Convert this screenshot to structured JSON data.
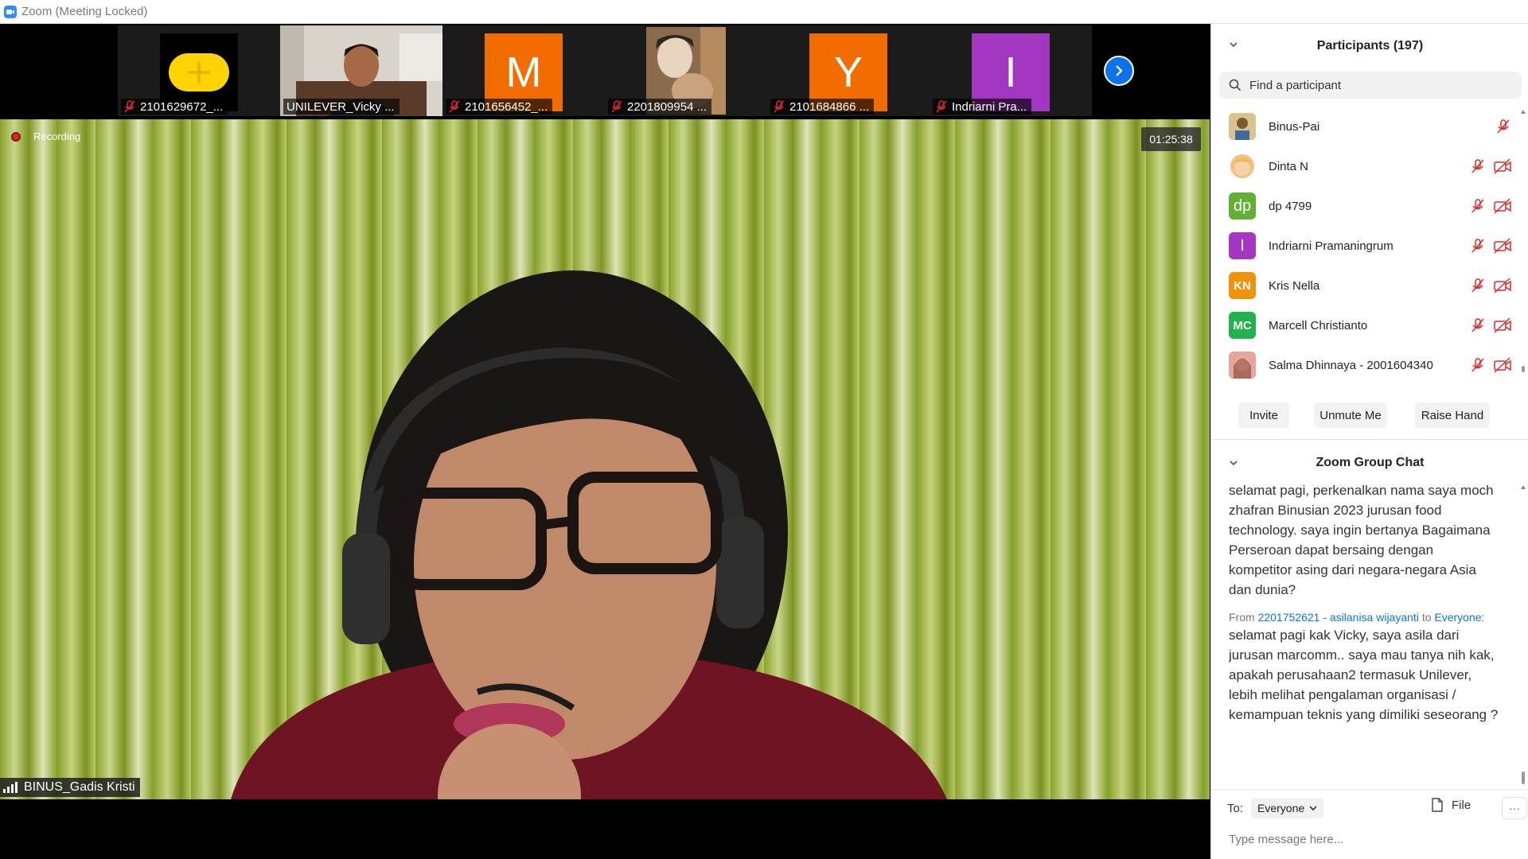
{
  "window": {
    "title": "Zoom (Meeting Locked)"
  },
  "thumbnails": [
    {
      "label": "2101629672_...",
      "avatar_text": "",
      "muted": true
    },
    {
      "label": "UNILEVER_Vicky ...",
      "avatar_text": "",
      "muted": false
    },
    {
      "label": "2101656452_...",
      "avatar_text": "M",
      "muted": true
    },
    {
      "label": "2201809954 ...",
      "avatar_text": "",
      "muted": true
    },
    {
      "label": "2101684866 ...",
      "avatar_text": "Y",
      "muted": true
    },
    {
      "label": "Indriarni Pra...",
      "avatar_text": "I",
      "muted": true
    }
  ],
  "main_video": {
    "recording_label": "Recording",
    "timer": "01:25:38",
    "speaker_name": "BINUS_Gadis Kristi"
  },
  "participants": {
    "title": "Participants (197)",
    "search_placeholder": "Find a participant",
    "items": [
      {
        "name": "Binus-Pai",
        "initials": "",
        "color": "#c9a257",
        "video_off": false
      },
      {
        "name": "Dinta N",
        "initials": "",
        "color": "#f2d39b",
        "video_off": true
      },
      {
        "name": "dp 4799",
        "initials": "dp",
        "color": "#62b036",
        "video_off": true
      },
      {
        "name": "Indriarni Pramaningrum",
        "initials": "I",
        "color": "#a437c1",
        "video_off": true
      },
      {
        "name": "Kris Nella",
        "initials": "KN",
        "color": "#f0930b",
        "video_off": true
      },
      {
        "name": "Marcell Christianto",
        "initials": "MC",
        "color": "#22b14c",
        "video_off": true
      },
      {
        "name": "Salma Dhinnaya - 2001604340",
        "initials": "",
        "color": "#d98a84",
        "video_off": true
      }
    ],
    "buttons": {
      "invite": "Invite",
      "unmute": "Unmute Me",
      "raise_hand": "Raise Hand"
    }
  },
  "chat": {
    "title": "Zoom Group Chat",
    "message1": "selamat pagi, perkenalkan nama saya moch zhafran Binusian 2023 jurusan food technology. saya ingin bertanya Bagaimana Perseroan dapat bersaing dengan kompetitor asing dari negara-negara Asia dan dunia?",
    "from_prefix": "From",
    "from_name": "2201752621 - asilanisa wijayanti",
    "from_to": "to",
    "from_target": "Everyone:",
    "message2": "selamat pagi kak Vicky, saya asila dari jurusan marcomm.. saya mau tanya nih kak, apakah perusahaan2 termasuk Unilever, lebih melihat pengalaman organisasi / kemampuan teknis yang dimiliki seseorang ?",
    "to_label": "To:",
    "to_value": "Everyone",
    "file_label": "File",
    "more_label": "···",
    "input_placeholder": "Type message here..."
  },
  "colors": {
    "zoom_blue": "#0e72ed",
    "muted_red": "#e02828",
    "orange_avatar": "#f26d00",
    "purple_avatar": "#a437c1",
    "yellow_avatar": "#ffd400"
  }
}
